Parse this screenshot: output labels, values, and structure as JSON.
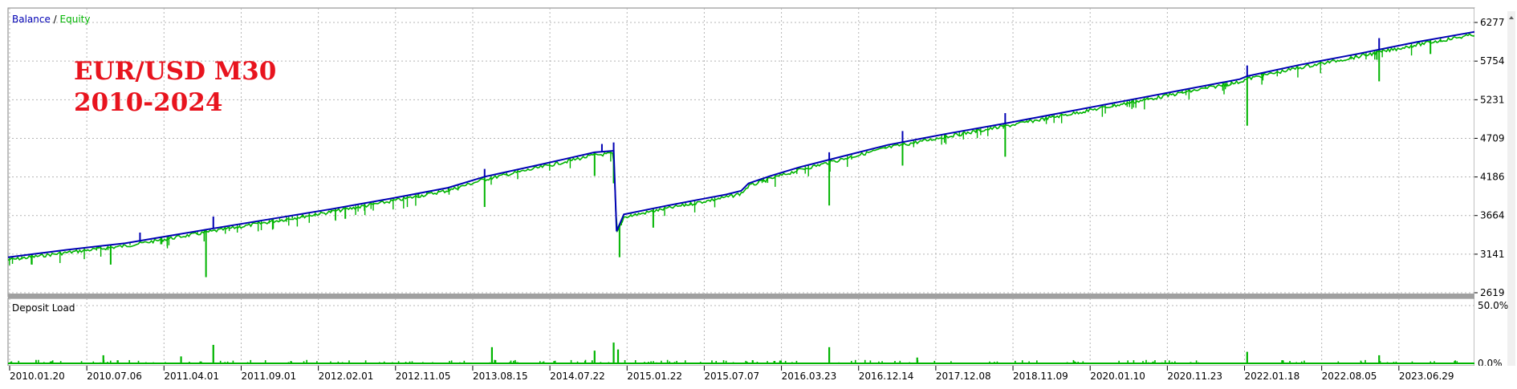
{
  "chart_data": [
    {
      "type": "line",
      "legend": {
        "balance_label": "Balance",
        "separator": " / ",
        "equity_label": "Equity",
        "placement": "top-left"
      },
      "overlay_title": [
        "EUR/USD M30",
        "2010-2024"
      ],
      "y_ticks": [
        6277,
        5754,
        5231,
        4709,
        4186,
        3664,
        3141,
        2619
      ],
      "ylim": [
        2619,
        6277
      ],
      "grid": true,
      "series": [
        {
          "name": "Balance",
          "color": "#0000b4",
          "x": [
            0,
            0.04,
            0.08,
            0.11,
            0.14,
            0.18,
            0.22,
            0.26,
            0.3,
            0.325,
            0.36,
            0.38,
            0.4,
            0.413,
            0.415,
            0.42,
            0.45,
            0.49,
            0.5,
            0.505,
            0.52,
            0.54,
            0.57,
            0.6,
            0.64,
            0.68,
            0.72,
            0.76,
            0.8,
            0.84,
            0.845,
            0.88,
            0.92,
            0.96,
            1.0
          ],
          "values": [
            3100,
            3200,
            3290,
            3390,
            3490,
            3620,
            3750,
            3890,
            4040,
            4190,
            4340,
            4430,
            4520,
            4540,
            3450,
            3680,
            3800,
            3950,
            4000,
            4100,
            4200,
            4320,
            4470,
            4620,
            4770,
            4910,
            5060,
            5210,
            5360,
            5510,
            5550,
            5700,
            5850,
            6010,
            6150
          ]
        },
        {
          "name": "Equity",
          "color": "#00b400",
          "spikes": [
            {
              "x": 0.135,
              "low": 2830
            },
            {
              "x": 0.07,
              "low": 3000
            },
            {
              "x": 0.23,
              "low": 3620
            },
            {
              "x": 0.325,
              "low": 3780
            },
            {
              "x": 0.4,
              "low": 4200
            },
            {
              "x": 0.413,
              "low": 4100
            },
            {
              "x": 0.417,
              "low": 3100
            },
            {
              "x": 0.44,
              "low": 3500
            },
            {
              "x": 0.56,
              "low": 3800
            },
            {
              "x": 0.61,
              "low": 4340
            },
            {
              "x": 0.68,
              "low": 4460
            },
            {
              "x": 0.845,
              "low": 4880
            },
            {
              "x": 0.935,
              "low": 5480
            },
            {
              "x": 0.97,
              "low": 5850
            }
          ]
        }
      ]
    },
    {
      "type": "bar",
      "title": "Deposit Load",
      "y_ticks": [
        "50.0%",
        "0.0%"
      ],
      "ylim": [
        0,
        50
      ],
      "color": "#00b400",
      "bars": [
        {
          "x": 0.065,
          "value": 7
        },
        {
          "x": 0.118,
          "value": 6
        },
        {
          "x": 0.14,
          "value": 16
        },
        {
          "x": 0.33,
          "value": 14
        },
        {
          "x": 0.4,
          "value": 11
        },
        {
          "x": 0.413,
          "value": 18
        },
        {
          "x": 0.416,
          "value": 12
        },
        {
          "x": 0.56,
          "value": 14
        },
        {
          "x": 0.845,
          "value": 10
        },
        {
          "x": 0.935,
          "value": 7
        },
        {
          "x": 0.62,
          "value": 5
        }
      ],
      "x_ticks": [
        "2010.01.20",
        "2010.07.06",
        "2011.04.01",
        "2011.09.01",
        "2012.02.01",
        "2012.11.05",
        "2013.08.15",
        "2014.07.22",
        "2015.01.22",
        "2015.07.07",
        "2016.03.23",
        "2016.12.14",
        "2017.12.08",
        "2018.11.09",
        "2020.01.10",
        "2020.11.23",
        "2022.01.18",
        "2022.08.05",
        "2023.06.29"
      ]
    }
  ]
}
